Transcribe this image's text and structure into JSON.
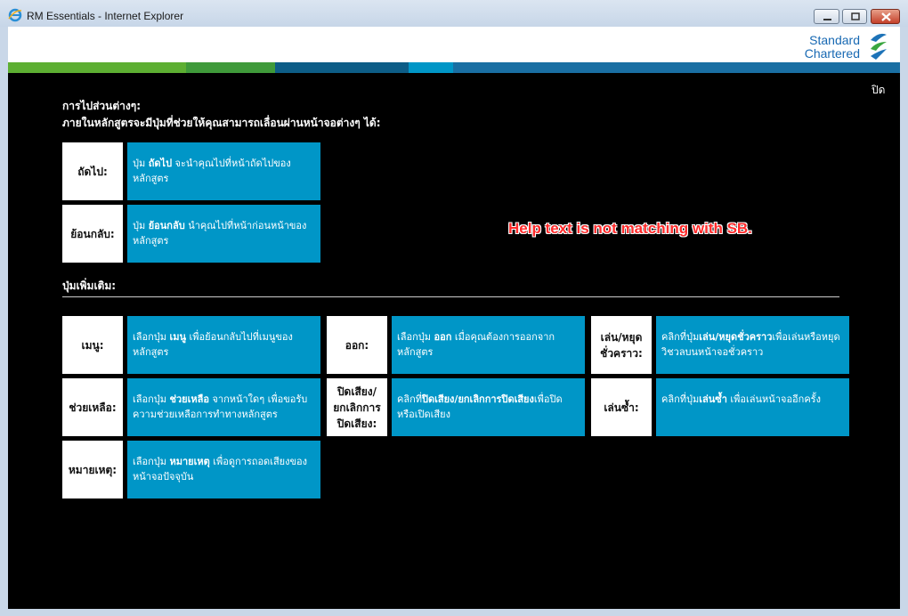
{
  "window": {
    "title": "RM Essentials - Internet Explorer"
  },
  "brand": {
    "line1": "Standard",
    "line2": "Chartered",
    "stripe_colors": [
      "#5daf32",
      "#3f9a3a",
      "#0d5d87",
      "#0096c7",
      "#1a6fa3"
    ]
  },
  "close_label": "ปิด",
  "navigation": {
    "title": "การไปส่วนต่างๆ:",
    "subtitle": "ภายในหลักสูตรจะมีปุ่มที่ช่วยให้คุณสามารถเลื่อนผ่านหน้าจอต่างๆ ได้:",
    "items": [
      {
        "label": "ถัดไป:",
        "desc_pre": "ปุ่ม ",
        "desc_bold": "ถัดไป",
        "desc_post": " จะนำคุณไปที่หน้าถัดไปของหลักสูตร"
      },
      {
        "label": "ย้อนกลับ:",
        "desc_pre": "ปุ่ม ",
        "desc_bold": "ย้อนกลับ",
        "desc_post": " นำคุณไปที่หน้าก่อนหน้าของหลักสูตร"
      }
    ]
  },
  "annotation": "Help text is not matching with SB.",
  "extra": {
    "title": "ปุ่มเพิ่มเติม:",
    "items": [
      {
        "label": "เมนู:",
        "desc_pre": "เลือกปุ่ม ",
        "desc_bold": "เมนู",
        "desc_post": " เพื่อย้อนกลับไปที่เมนูของหลักสูตร"
      },
      {
        "label": "ช่วยเหลือ:",
        "desc_pre": "เลือกปุ่ม ",
        "desc_bold": "ช่วยเหลือ",
        "desc_post": " จากหน้าใดๆ เพื่อขอรับความช่วยเหลือการทำทางหลักสูตร"
      },
      {
        "label": "หมายเหตุ:",
        "desc_pre": "เลือกปุ่ม ",
        "desc_bold": "หมายเหตุ",
        "desc_post": " เพื่อดูการถอดเสียงของหน้าจอปัจจุบัน"
      },
      {
        "label": "ออก:",
        "desc_pre": "เลือกปุ่ม ",
        "desc_bold": "ออก",
        "desc_post": " เมื่อคุณต้องการออกจากหลักสูตร"
      },
      {
        "label": "ปิดเสียง/ยกเลิกการปิดเสียง:",
        "desc_pre": "คลิกที่",
        "desc_bold": "ปิดเสียง/ยกเลิกการปิดเสียง",
        "desc_post": "เพื่อปิดหรือเปิดเสียง"
      },
      {
        "label": "เล่น/หยุดชั่วคราว:",
        "desc_pre": "คลิกที่ปุ่ม",
        "desc_bold": "เล่น/หยุดชั่วคราว",
        "desc_post": "เพื่อเล่นหรือหยุดวิชวลบนหน้าจอชั่วคราว"
      },
      {
        "label": "เล่นซ้ำ:",
        "desc_pre": "คลิกที่ปุ่ม",
        "desc_bold": "เล่นซ้ำ",
        "desc_post": " เพื่อเล่นหน้าจออีกครั้ง"
      }
    ]
  }
}
